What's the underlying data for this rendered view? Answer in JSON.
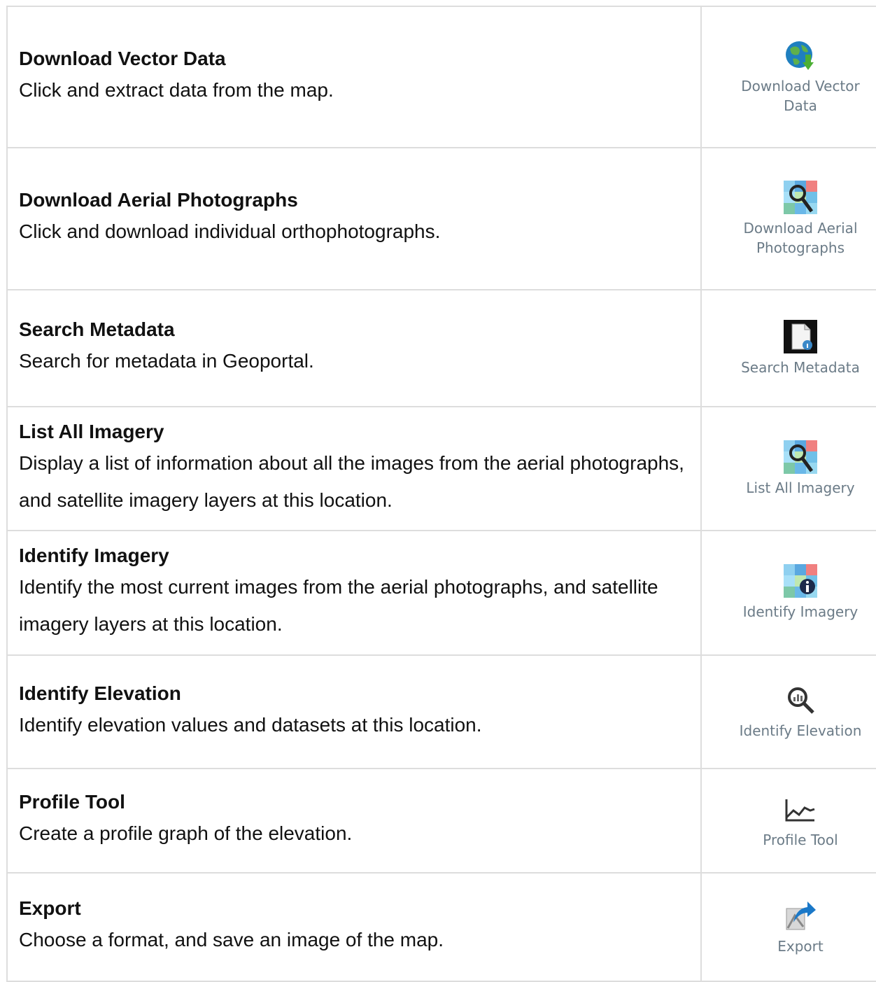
{
  "rows": [
    {
      "title": "Download Vector Data",
      "desc": "Click and extract data from the map.",
      "tool_label": "Download Vector Data",
      "icon": "globe-download-icon"
    },
    {
      "title": "Download Aerial Photographs",
      "desc": "Click and download individual orthophotographs.",
      "tool_label": "Download Aerial Photographs",
      "icon": "aerial-search-icon"
    },
    {
      "title": "Search Metadata",
      "desc": "Search for metadata in Geoportal.",
      "tool_label": "Search Metadata",
      "icon": "document-search-icon"
    },
    {
      "title": "List All Imagery",
      "desc": "Display a list of information about all the images from the aerial photographs, and satellite imagery layers at this location.",
      "tool_label": "List All Imagery",
      "icon": "imagery-search-icon"
    },
    {
      "title": "Identify Imagery",
      "desc": "Identify the most current images from the aerial photographs, and satellite imagery layers at this location.",
      "tool_label": "Identify Imagery",
      "icon": "imagery-info-icon"
    },
    {
      "title": "Identify Elevation",
      "desc": "Identify elevation values and datasets at this location.",
      "tool_label": "Identify Elevation",
      "icon": "elevation-search-icon"
    },
    {
      "title": "Profile Tool",
      "desc": "Create a profile graph of the elevation.",
      "tool_label": "Profile Tool",
      "icon": "profile-graph-icon"
    },
    {
      "title": "Export",
      "desc": "Choose a format, and save an image of the map.",
      "tool_label": "Export",
      "icon": "export-arrow-icon"
    }
  ]
}
